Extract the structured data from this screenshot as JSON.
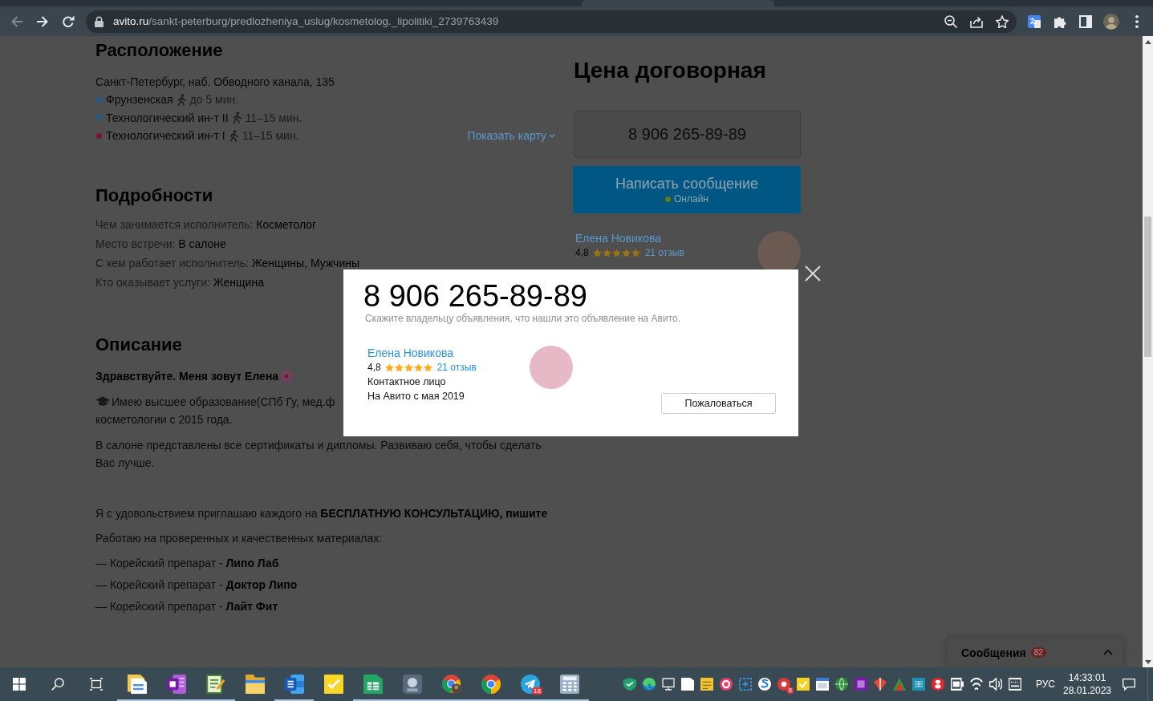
{
  "browser": {
    "nav_buttons": [
      {
        "kind": "back",
        "disabled": true
      },
      {
        "kind": "forward",
        "disabled": false
      },
      {
        "kind": "reload",
        "disabled": false
      }
    ],
    "address_bar": {
      "domain": "avito.ru",
      "path": "/sankt-peterburg/predlozheniya_uslug/kosmetolog._lipolitiki_2739763439"
    },
    "address_actions": [
      {
        "kind": "zoom"
      },
      {
        "kind": "share"
      },
      {
        "kind": "bookmark"
      }
    ],
    "toolbar_buttons": [
      {
        "kind": "translate"
      },
      {
        "kind": "extensions"
      },
      {
        "kind": "side-panel"
      },
      {
        "kind": "profile"
      },
      {
        "kind": "menu"
      }
    ]
  },
  "location": {
    "heading": "Расположение",
    "address": "Санкт-Петербург, наб. Обводного канала, 135",
    "metro": [
      {
        "name": "Фрунзенская",
        "color": "#1f5d8e",
        "time": "до 5 мин."
      },
      {
        "name": "Технологический ин-т II",
        "color": "#1f5d8e",
        "time": "11–15 мин."
      },
      {
        "name": "Технологический ин-т I",
        "color": "#7e1434",
        "time": "11–15 мин."
      }
    ],
    "map_link": "Показать карту"
  },
  "details": {
    "heading": "Подробности",
    "rows": [
      {
        "label": "Чем занимается исполнитель:",
        "value": "Косметолог"
      },
      {
        "label": "Место встречи:",
        "value": "В салоне"
      },
      {
        "label": "С кем работает исполнитель:",
        "value": "Женщины, Мужчины"
      },
      {
        "label": "Кто оказывает услуги:",
        "value": "Женщина"
      }
    ]
  },
  "description": {
    "heading": "Описание",
    "greeting": "Здравствуйте. Меня зовут Елена",
    "education_lines": [
      "Имею высшее образование(СПб Гу, мед.ф",
      "косметологии с 2015 года."
    ],
    "paragraphs": [
      "В салоне представлены все сертификаты и дипломы. Развиваю себя, чтобы сделать Вас лучше.",
      "Я с удовольствием приглашаю каждого на **БЕСПЛАТНУЮ КОНСУЛЬТАЦИЮ, пишите**",
      "Работаю на проверенных и качественных материалах:"
    ],
    "products": [
      "— Корейский препарат - **Липо Лаб**",
      "— Корейский препарат - **Доктор Липо**",
      "— Корейский препарат - **Лайт Фит**"
    ]
  },
  "price": {
    "title": "Цена договорная",
    "phone": "8 906 265-89-89",
    "message_button": {
      "label": "Написать сообщение",
      "status": "Онлайн",
      "online": true
    },
    "seller": {
      "name": "Елена Новикова",
      "rating": "4,8",
      "stars": 5,
      "reviews": "21 отзыв"
    }
  },
  "messages_widget": {
    "label": "Сообщения",
    "count": "82"
  },
  "modal": {
    "phone": "8 906 265-89-89",
    "hint": "Скажите владельцу объявления, что нашли это объявление на Авито.",
    "seller": {
      "name": "Елена Новикова",
      "rating": "4,8",
      "stars": 5,
      "reviews": "21 отзыв",
      "role": "Контактное лицо",
      "since": "На Авито с мая 2019"
    },
    "report_button": "Пожаловаться"
  },
  "taskbar": {
    "system_buttons": [
      {
        "kind": "start"
      },
      {
        "kind": "search"
      },
      {
        "kind": "task-view"
      }
    ],
    "apps": [
      {
        "kind": "document",
        "running": true
      },
      {
        "kind": "notebook",
        "running": true
      },
      {
        "kind": "notepad",
        "running": true
      },
      {
        "kind": "folder",
        "running": false
      },
      {
        "kind": "word",
        "running": true
      },
      {
        "kind": "sticky",
        "running": false
      },
      {
        "kind": "spreadsheet",
        "running": true
      },
      {
        "kind": "tool",
        "running": true
      },
      {
        "kind": "browser-profile",
        "running": true
      },
      {
        "kind": "browser",
        "running": true
      },
      {
        "kind": "messenger",
        "running": true,
        "badge": "18"
      },
      {
        "kind": "calculator",
        "running": true
      }
    ],
    "tray": [
      {
        "kind": "shield"
      },
      {
        "kind": "edge"
      },
      {
        "kind": "monitor"
      },
      {
        "kind": "doc"
      },
      {
        "kind": "notes"
      },
      {
        "kind": "target"
      },
      {
        "kind": "capture"
      },
      {
        "kind": "swirl"
      },
      {
        "kind": "ring",
        "badge": "8"
      },
      {
        "kind": "check"
      },
      {
        "kind": "window"
      },
      {
        "kind": "globe"
      },
      {
        "kind": "notebook-small"
      },
      {
        "kind": "diamond"
      },
      {
        "kind": "triangle"
      },
      {
        "kind": "formula"
      },
      {
        "kind": "capsule"
      },
      {
        "kind": "battery"
      },
      {
        "kind": "wifi"
      },
      {
        "kind": "speaker"
      },
      {
        "kind": "keyboard"
      }
    ],
    "language": "РУС",
    "time": "14:33:01",
    "date": "28.01.2023",
    "end_buttons": [
      {
        "kind": "notifications"
      }
    ]
  }
}
